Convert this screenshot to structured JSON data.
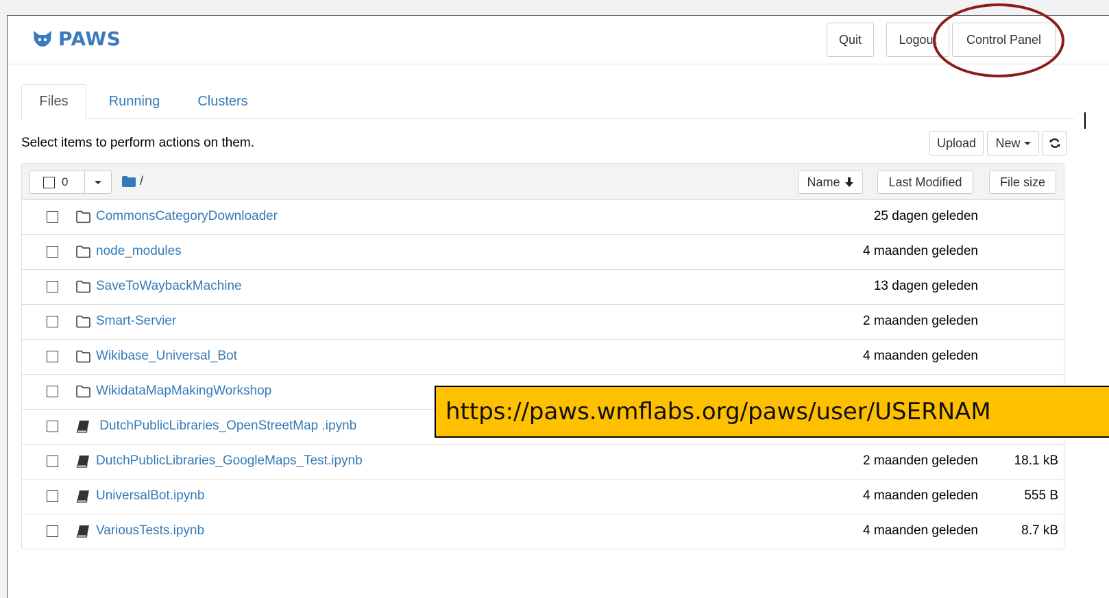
{
  "app": {
    "logo_text": "PAWS"
  },
  "header": {
    "quit_label": "Quit",
    "logout_label": "Logout",
    "control_panel_label": "Control Panel"
  },
  "tabs": [
    {
      "label": "Files",
      "active": true
    },
    {
      "label": "Running",
      "active": false
    },
    {
      "label": "Clusters",
      "active": false
    }
  ],
  "toolbar": {
    "hint": "Select items to perform actions on them.",
    "upload_label": "Upload",
    "new_label": "New"
  },
  "list_header": {
    "selected_count": "0",
    "breadcrumb": "/",
    "sort_name_label": "Name",
    "sort_modified_label": "Last Modified",
    "sort_size_label": "File size"
  },
  "files": [
    {
      "type": "folder",
      "name": "CommonsCategoryDownloader",
      "modified": "25 dagen geleden",
      "size": ""
    },
    {
      "type": "folder",
      "name": "node_modules",
      "modified": "4 maanden geleden",
      "size": ""
    },
    {
      "type": "folder",
      "name": "SaveToWaybackMachine",
      "modified": "13 dagen geleden",
      "size": ""
    },
    {
      "type": "folder",
      "name": "Smart-Servier",
      "modified": "2 maanden geleden",
      "size": ""
    },
    {
      "type": "folder",
      "name": "Wikibase_Universal_Bot",
      "modified": "4 maanden geleden",
      "size": ""
    },
    {
      "type": "folder",
      "name": "WikidataMapMakingWorkshop",
      "modified": "",
      "size": ""
    },
    {
      "type": "notebook",
      "name": " DutchPublicLibraries_OpenStreetMap .ipynb",
      "modified": "",
      "size": ""
    },
    {
      "type": "notebook",
      "name": "DutchPublicLibraries_GoogleMaps_Test.ipynb",
      "modified": "2 maanden geleden",
      "size": "18.1 kB"
    },
    {
      "type": "notebook",
      "name": "UniversalBot.ipynb",
      "modified": "4 maanden geleden",
      "size": "555 B"
    },
    {
      "type": "notebook",
      "name": "VariousTests.ipynb",
      "modified": "4 maanden geleden",
      "size": "8.7 kB"
    }
  ],
  "callout": {
    "text": "https://paws.wmflabs.org/paws/user/USERNAM"
  },
  "colors": {
    "link": "#337ab7",
    "highlight_ring": "#8c1c1c",
    "callout_bg": "#ffc000",
    "logo": "#3a7bbf"
  }
}
